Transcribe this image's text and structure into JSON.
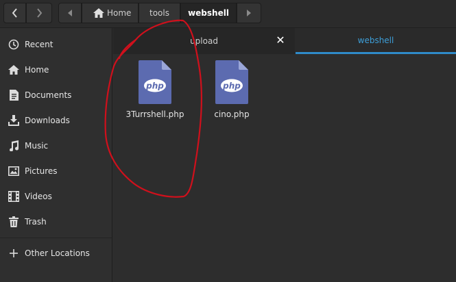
{
  "header": {
    "back_icon": "chevron-left-icon",
    "forward_icon": "chevron-right-icon",
    "path_scroll_left_icon": "triangle-left-icon",
    "path_scroll_right_icon": "triangle-right-icon",
    "breadcrumbs": [
      {
        "label": "Home",
        "icon": "home-icon"
      },
      {
        "label": "tools"
      },
      {
        "label": "webshell",
        "current": true
      }
    ]
  },
  "sidebar": {
    "items": [
      {
        "label": "Recent",
        "icon": "clock-icon"
      },
      {
        "label": "Home",
        "icon": "home-icon"
      },
      {
        "label": "Documents",
        "icon": "document-icon"
      },
      {
        "label": "Downloads",
        "icon": "download-icon"
      },
      {
        "label": "Music",
        "icon": "music-note-icon"
      },
      {
        "label": "Pictures",
        "icon": "picture-icon"
      },
      {
        "label": "Videos",
        "icon": "film-icon"
      },
      {
        "label": "Trash",
        "icon": "trash-icon"
      },
      {
        "label": "Other Locations",
        "icon": "plus-icon"
      }
    ]
  },
  "tabs": [
    {
      "label": "upload",
      "active": false,
      "close_icon": "close-icon"
    },
    {
      "label": "webshell",
      "active": true
    }
  ],
  "files": [
    {
      "name": "3Turrshell.php",
      "icon": "php-file-icon",
      "icon_text": "php"
    },
    {
      "name": "cino.php",
      "icon": "php-file-icon",
      "icon_text": "php"
    }
  ],
  "annotation": {
    "color": "#d0101c",
    "shape": "freehand-circle"
  },
  "colors": {
    "accent": "#2f8bc9",
    "php_icon": "#5c6bb0",
    "background": "#2d2d2d"
  }
}
